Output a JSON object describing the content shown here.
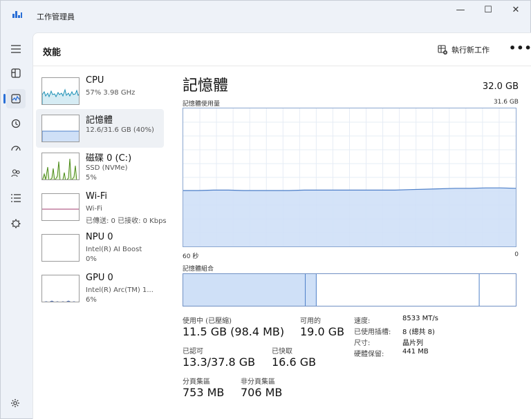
{
  "window": {
    "title": "工作管理員",
    "minimize": "—",
    "maximize": "☐",
    "close": "✕"
  },
  "nav": {
    "icons": [
      "hamburger-icon",
      "processes-icon",
      "performance-icon",
      "app-history-icon",
      "startup-apps-icon",
      "users-icon",
      "details-icon",
      "services-icon",
      "settings-icon"
    ]
  },
  "header": {
    "title": "效能",
    "run_task": "執行新工作",
    "more": "•••"
  },
  "resources": [
    {
      "name": "CPU",
      "line1": "57%  3.98 GHz",
      "line2": ""
    },
    {
      "name": "記憶體",
      "line1": "12.6/31.6 GB (40%)",
      "line2": ""
    },
    {
      "name": "磁碟 0 (C:)",
      "line1": "SSD (NVMe)",
      "line2": "5%"
    },
    {
      "name": "Wi-Fi",
      "line1": "Wi-Fi",
      "line2": "已傳送: 0 已接收: 0 Kbps"
    },
    {
      "name": "NPU 0",
      "line1": "Intel(R) AI Boost",
      "line2": "0%"
    },
    {
      "name": "GPU 0",
      "line1": "Intel(R) Arc(TM) 1...",
      "line2": "6%"
    }
  ],
  "detail": {
    "title": "記憶體",
    "total": "32.0 GB",
    "usage_label": "記憶體使用量",
    "usage_max": "31.6 GB",
    "time_left": "60 秒",
    "time_right": "0",
    "composition_label": "記憶體組合"
  },
  "chart_data": {
    "type": "area",
    "title": "記憶體使用量",
    "xlabel": "",
    "ylabel": "",
    "x_range_label": [
      "60 秒",
      "0"
    ],
    "ylim": [
      0,
      31.6
    ],
    "series": [
      {
        "values": [
          12.8,
          12.8,
          12.9,
          12.9,
          12.8,
          12.8,
          12.8,
          12.8,
          12.9,
          12.9,
          12.9,
          12.9,
          12.9,
          12.9,
          12.9,
          13.0,
          13.1,
          13.2,
          13.3,
          13.3,
          13.4,
          13.4,
          13.3
        ]
      }
    ],
    "composition": [
      {
        "segment": "in_use",
        "fraction": 0.367
      },
      {
        "segment": "modified",
        "fraction": 0.033
      },
      {
        "segment": "standby",
        "fraction": 0.49
      },
      {
        "segment": "free",
        "fraction": 0.11
      }
    ]
  },
  "stats": {
    "in_use_label": "使用中 (已壓縮)",
    "in_use_value": "11.5 GB (98.4 MB)",
    "available_label": "可用的",
    "available_value": "19.0 GB",
    "committed_label": "已認可",
    "committed_value": "13.3/37.8 GB",
    "cached_label": "已快取",
    "cached_value": "16.6 GB",
    "paged_label": "分頁集區",
    "paged_value": "753 MB",
    "nonpaged_label": "非分頁集區",
    "nonpaged_value": "706 MB"
  },
  "specs": {
    "speed_label": "速度:",
    "speed_value": "8533 MT/s",
    "slots_label": "已使用插槽:",
    "slots_value": "8 (總共 8)",
    "form_label": "尺寸:",
    "form_value": "晶片列",
    "reserved_label": "硬體保留:",
    "reserved_value": "441 MB"
  },
  "colors": {
    "accent": "#2a6fd6",
    "memory_fill": "#cfe0f7",
    "memory_line": "#4d7fc8",
    "cpu_line": "#1b8fb4",
    "disk_line": "#4a8a16",
    "wifi_line": "#a13a6e",
    "gpu_line": "#3b5ea8"
  }
}
